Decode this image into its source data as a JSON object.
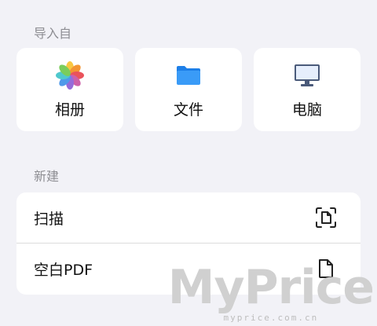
{
  "sections": {
    "import_label": "导入自",
    "new_label": "新建"
  },
  "import_options": [
    {
      "label": "相册",
      "icon": "photos-icon"
    },
    {
      "label": "文件",
      "icon": "folder-icon"
    },
    {
      "label": "电脑",
      "icon": "computer-icon"
    }
  ],
  "new_options": [
    {
      "label": "扫描",
      "icon": "scan-document-icon"
    },
    {
      "label": "空白PDF",
      "icon": "blank-document-icon"
    }
  ],
  "watermark": {
    "main": "MyPrice",
    "sub": "myprice.com.cn"
  },
  "colors": {
    "background": "#f2f2f7",
    "card": "#ffffff",
    "folder": "#2f8ff5",
    "section_label": "#8e8e93"
  }
}
